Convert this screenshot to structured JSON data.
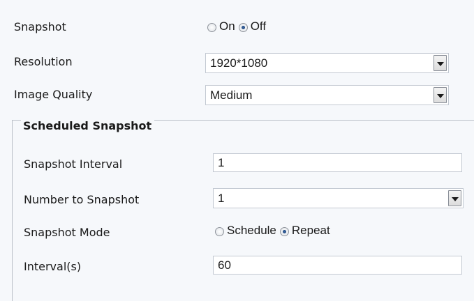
{
  "snapshot": {
    "label": "Snapshot",
    "options": [
      "On",
      "Off"
    ],
    "selected": "Off"
  },
  "resolution": {
    "label": "Resolution",
    "value": "1920*1080"
  },
  "image_quality": {
    "label": "Image Quality",
    "value": "Medium"
  },
  "scheduled": {
    "title": "Scheduled Snapshot",
    "interval": {
      "label": "Snapshot Interval",
      "value": "1"
    },
    "number": {
      "label": "Number to Snapshot",
      "value": "1"
    },
    "mode": {
      "label": "Snapshot Mode",
      "options": [
        "Schedule",
        "Repeat"
      ],
      "selected": "Repeat"
    },
    "interval_s": {
      "label": "Interval(s)",
      "value": "60"
    }
  }
}
